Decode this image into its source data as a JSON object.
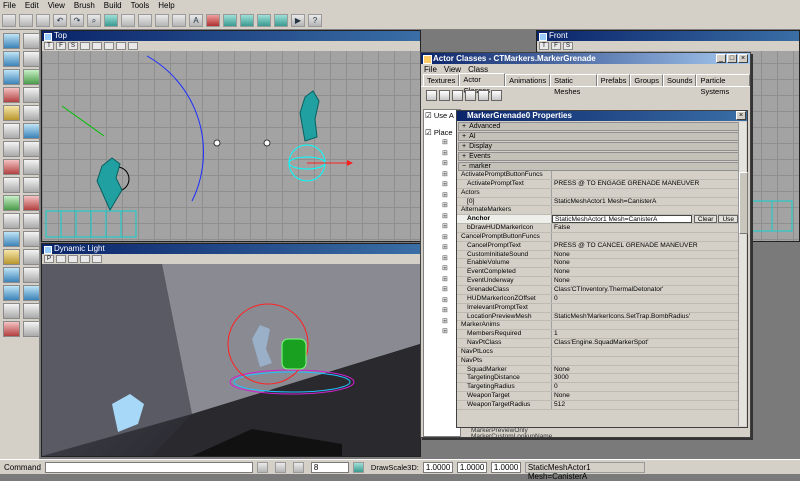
{
  "menu": [
    "File",
    "Edit",
    "View",
    "Brush",
    "Build",
    "Tools",
    "Help"
  ],
  "viewports": {
    "top": "Top",
    "front": "Front",
    "dynamic": "Dynamic Light"
  },
  "status": {
    "command_label": "Command",
    "draw_scale_label": "DrawScale3D:",
    "scale_x": "1.0000",
    "scale_y": "1.0000",
    "scale_z": "1.0000",
    "snap": "8",
    "selection": "StaticMeshActor1 Mesh=CanisterA"
  },
  "actor_window": {
    "title": "Actor Classes - CTMarkers.MarkerGrenade",
    "menu": [
      "File",
      "View",
      "Class"
    ],
    "tabs": [
      "Textures",
      "Actor Classes",
      "Animations",
      "Static Meshes",
      "Prefabs",
      "Groups",
      "Sounds",
      "Particle Systems"
    ],
    "checks": [
      "Use A",
      "Place"
    ]
  },
  "properties": {
    "title": "MarkerGrenade0 Properties",
    "categories": [
      "Advanced",
      "AI",
      "Display",
      "Events"
    ],
    "open_category": "marker",
    "rows": [
      {
        "n": "ActivatePromptButtonFuncs",
        "v": "",
        "g": true
      },
      {
        "n": "ActivatePromptText",
        "v": "PRESS @ TO ENGAGE GRENADE MANEUVER"
      },
      {
        "n": "Actors",
        "v": "",
        "g": true
      },
      {
        "n": "[0]",
        "v": "StaticMeshActor1 Mesh=CanisterA"
      },
      {
        "n": "AlternateMarkers",
        "v": "",
        "g": true
      },
      {
        "n": "Anchor",
        "v": "StaticMeshActor1 Mesh=CanisterA",
        "sel": true
      },
      {
        "n": "bDrawHUDMarkerIcon",
        "v": "False"
      },
      {
        "n": "CancelPromptButtonFuncs",
        "v": "",
        "g": true
      },
      {
        "n": "CancelPromptText",
        "v": "PRESS @ TO CANCEL GRENADE MANEUVER"
      },
      {
        "n": "CustomInitiateSound",
        "v": "None"
      },
      {
        "n": "EnableVolume",
        "v": "None"
      },
      {
        "n": "EventCompleted",
        "v": "None"
      },
      {
        "n": "EventUnderway",
        "v": "None"
      },
      {
        "n": "GrenadeClass",
        "v": "Class'CTInventory.ThermalDetonator'"
      },
      {
        "n": "HUDMarkerIconZOffset",
        "v": "0"
      },
      {
        "n": "IrrelevantPromptText",
        "v": ""
      },
      {
        "n": "LocationPreviewMesh",
        "v": "StaticMesh'MarkerIcons.SetTrap.BombRadius'"
      },
      {
        "n": "MarkerAnims",
        "v": "",
        "g": true
      },
      {
        "n": "MembersRequired",
        "v": "1"
      },
      {
        "n": "NavPtClass",
        "v": "Class'Engine.SquadMarkerSpot'"
      },
      {
        "n": "NavPtLocs",
        "v": "",
        "g": true
      },
      {
        "n": "NavPts",
        "v": "",
        "g": true
      },
      {
        "n": "SquadMarker",
        "v": "None"
      },
      {
        "n": "TargetingDistance",
        "v": "3000"
      },
      {
        "n": "TargetingRadius",
        "v": "0"
      },
      {
        "n": "WeaponTarget",
        "v": "None"
      },
      {
        "n": "WeaponTargetRadius",
        "v": "512"
      }
    ],
    "clear": "Clear",
    "use": "Use",
    "footer": [
      "MarkerPreviewOnly",
      "MarkerCustomLookupName"
    ]
  }
}
